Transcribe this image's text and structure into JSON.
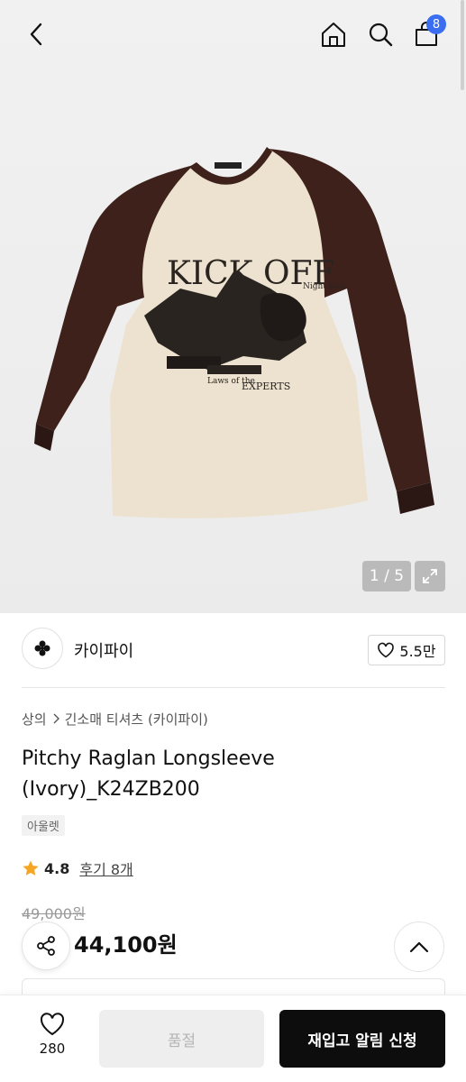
{
  "header": {
    "cart_count": "8"
  },
  "gallery": {
    "counter": "1 / 5",
    "print_text": {
      "headline": "KICK OFF",
      "tag_text": "Night kick",
      "footer": "EXPERTS",
      "small_line": "Laws of the"
    },
    "colors": {
      "body": "#ece2cf",
      "sleeve": "#3d211a",
      "print": "#2a2420"
    }
  },
  "brand": {
    "name": "카이파이",
    "likes": "5.5만"
  },
  "product": {
    "breadcrumb": [
      "상의",
      "긴소매 티셔츠 (카이파이)"
    ],
    "title": "Pitchy Raglan Longsleeve (Ivory)_K24ZB200",
    "tag": "아울렛",
    "rating": "4.8",
    "reviews": "후기 8개",
    "original_price": "49,000원",
    "price": "44,100원"
  },
  "bottom_bar": {
    "wish_count": "280",
    "soldout_label": "품절",
    "restock_label": "재입고 알림 신청"
  },
  "colors": {
    "accent_badge": "#3a6df0",
    "star": "#f5a623",
    "cta": "#0d0d0d"
  }
}
